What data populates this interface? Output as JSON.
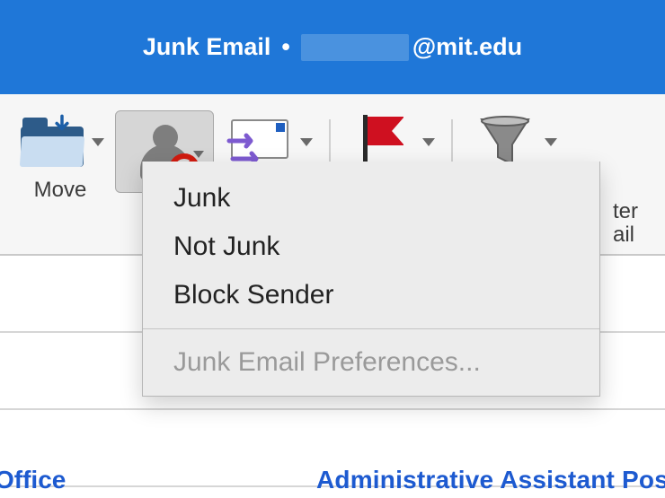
{
  "header": {
    "folder": "Junk Email",
    "separator": "•",
    "email_domain": "@mit.edu"
  },
  "toolbar": {
    "move_label": "Move",
    "filter_partial_line1": "ter",
    "filter_partial_line2": "ail"
  },
  "menu": {
    "items": [
      {
        "label": "Junk",
        "enabled": true
      },
      {
        "label": "Not Junk",
        "enabled": true
      },
      {
        "label": "Block Sender",
        "enabled": true
      }
    ],
    "preferences_label": "Junk Email Preferences...",
    "preferences_enabled": false
  },
  "content": {
    "left_partial": "Office",
    "right_partial": "Administrative Assistant Pos"
  }
}
